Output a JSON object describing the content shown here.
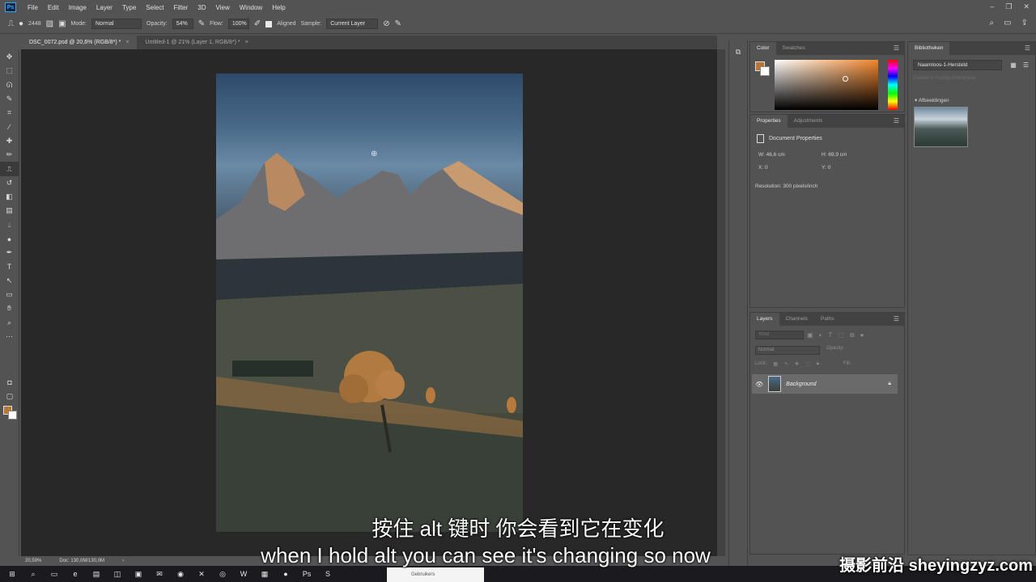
{
  "app": {
    "logo": "Ps"
  },
  "menu": [
    "File",
    "Edit",
    "Image",
    "Layer",
    "Type",
    "Select",
    "Filter",
    "3D",
    "View",
    "Window",
    "Help"
  ],
  "window_controls": [
    "–",
    "❐",
    "✕"
  ],
  "options": {
    "brush_size": "2448",
    "mode_label": "Mode:",
    "mode_value": "Normal",
    "opacity_label": "Opacity:",
    "opacity_value": "54%",
    "flow_label": "Flow:",
    "flow_value": "100%",
    "aligned_label": "Aligned",
    "sample_label": "Sample:",
    "sample_value": "Current Layer"
  },
  "doc_tabs": [
    {
      "label": "DSC_0072.psd @ 20,6% (RGB/8*) *",
      "close": "×"
    },
    {
      "label": "Untitled-1 @ 21% (Layer 1, RGB/8*) *",
      "close": "×"
    }
  ],
  "status": {
    "zoom": "20,59%",
    "doc": "Doc: 130,0M/130,0M",
    "arrow": "›"
  },
  "color_panel": {
    "tabs": [
      "Color",
      "Swatches"
    ],
    "fg_color": "#b97535",
    "bg_color": "#ffffff"
  },
  "properties_panel": {
    "tabs": [
      "Properties",
      "Adjustments"
    ],
    "title": "Document Properties",
    "w_label": "W:",
    "w_value": "46,6 cm",
    "h_label": "H:",
    "h_value": "69,9 cm",
    "x_label": "X:",
    "x_value": "0",
    "y_label": "Y:",
    "y_value": "0",
    "resolution": "Resolution: 300 pixels/inch"
  },
  "layers_panel": {
    "tabs": [
      "Layers",
      "Channels",
      "Paths"
    ],
    "search_placeholder": "Kind",
    "blend_mode": "Normal",
    "opacity_label": "Opacity:",
    "lock_label": "Lock:",
    "fill_label": "Fill:",
    "layer_name": "Background"
  },
  "library_panel": {
    "tab": "Bibliotheken",
    "library_name": "Naamloos-1-Hersteld",
    "search_placeholder": "Zoeken in huidige bibliotheek",
    "section": "Afbeeldingen"
  },
  "taskbar": {
    "explorer_label": "Gebruikers"
  },
  "subtitles": {
    "zh": "按住 alt 键时 你会看到它在变化",
    "en": "when I hold alt you can see it's changing so now"
  },
  "watermark": "摄影前沿 sheyingzyz.com"
}
